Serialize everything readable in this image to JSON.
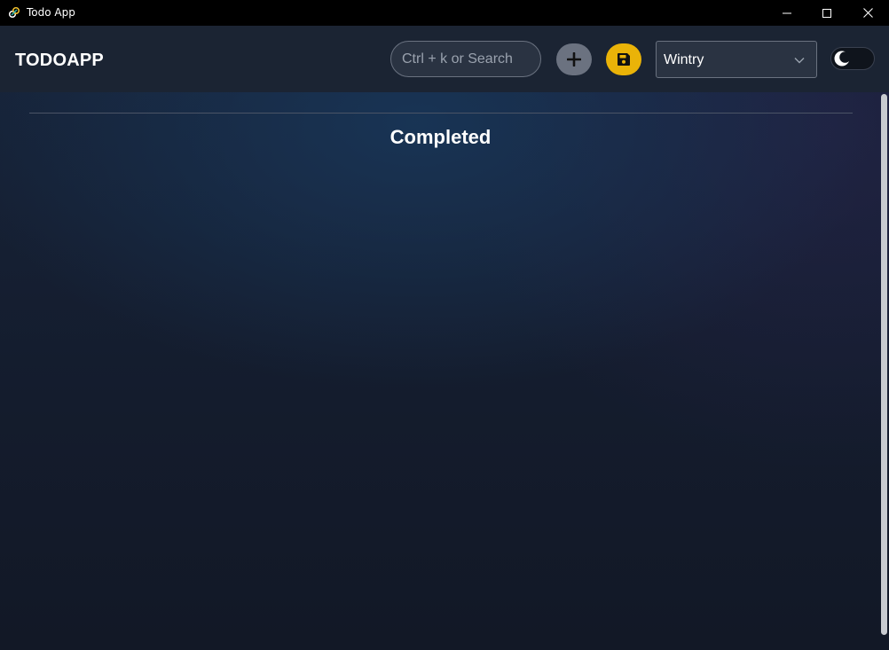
{
  "window": {
    "title": "Todo App",
    "icons": {
      "app": "link-icon",
      "minimize": "minimize-icon",
      "maximize": "maximize-icon",
      "close": "close-icon"
    }
  },
  "navbar": {
    "brand": "TODOAPP",
    "search": {
      "placeholder": "Ctrl + k or Search",
      "value": ""
    },
    "add_button_icon": "plus-icon",
    "save_button_icon": "floppy-disk-icon",
    "theme_select": {
      "selected": "Wintry"
    },
    "dark_mode_toggle": {
      "icon": "moon-icon",
      "on": false
    }
  },
  "main": {
    "section_title": "Completed"
  },
  "colors": {
    "navbar_bg": "#1b2433",
    "accent_save": "#eab308",
    "add_button": "#6b7280",
    "text": "#ffffff"
  }
}
